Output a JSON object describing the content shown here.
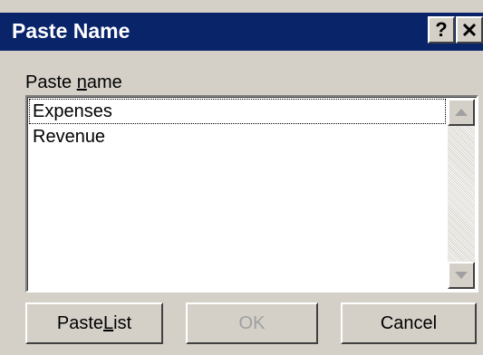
{
  "window": {
    "title": "Paste Name",
    "help_label": "?"
  },
  "list": {
    "label_prefix": "Paste ",
    "label_mnemonic": "n",
    "label_suffix": "ame",
    "items": [
      "Expenses",
      "Revenue"
    ],
    "focused_index": 0
  },
  "buttons": {
    "paste_list_prefix": "Paste ",
    "paste_list_mnemonic": "L",
    "paste_list_suffix": "ist",
    "ok": "OK",
    "ok_disabled": true,
    "cancel": "Cancel"
  },
  "colors": {
    "titlebar": "#0a246a",
    "face": "#d4d0c8",
    "disabled_text": "#a0a0a0"
  }
}
